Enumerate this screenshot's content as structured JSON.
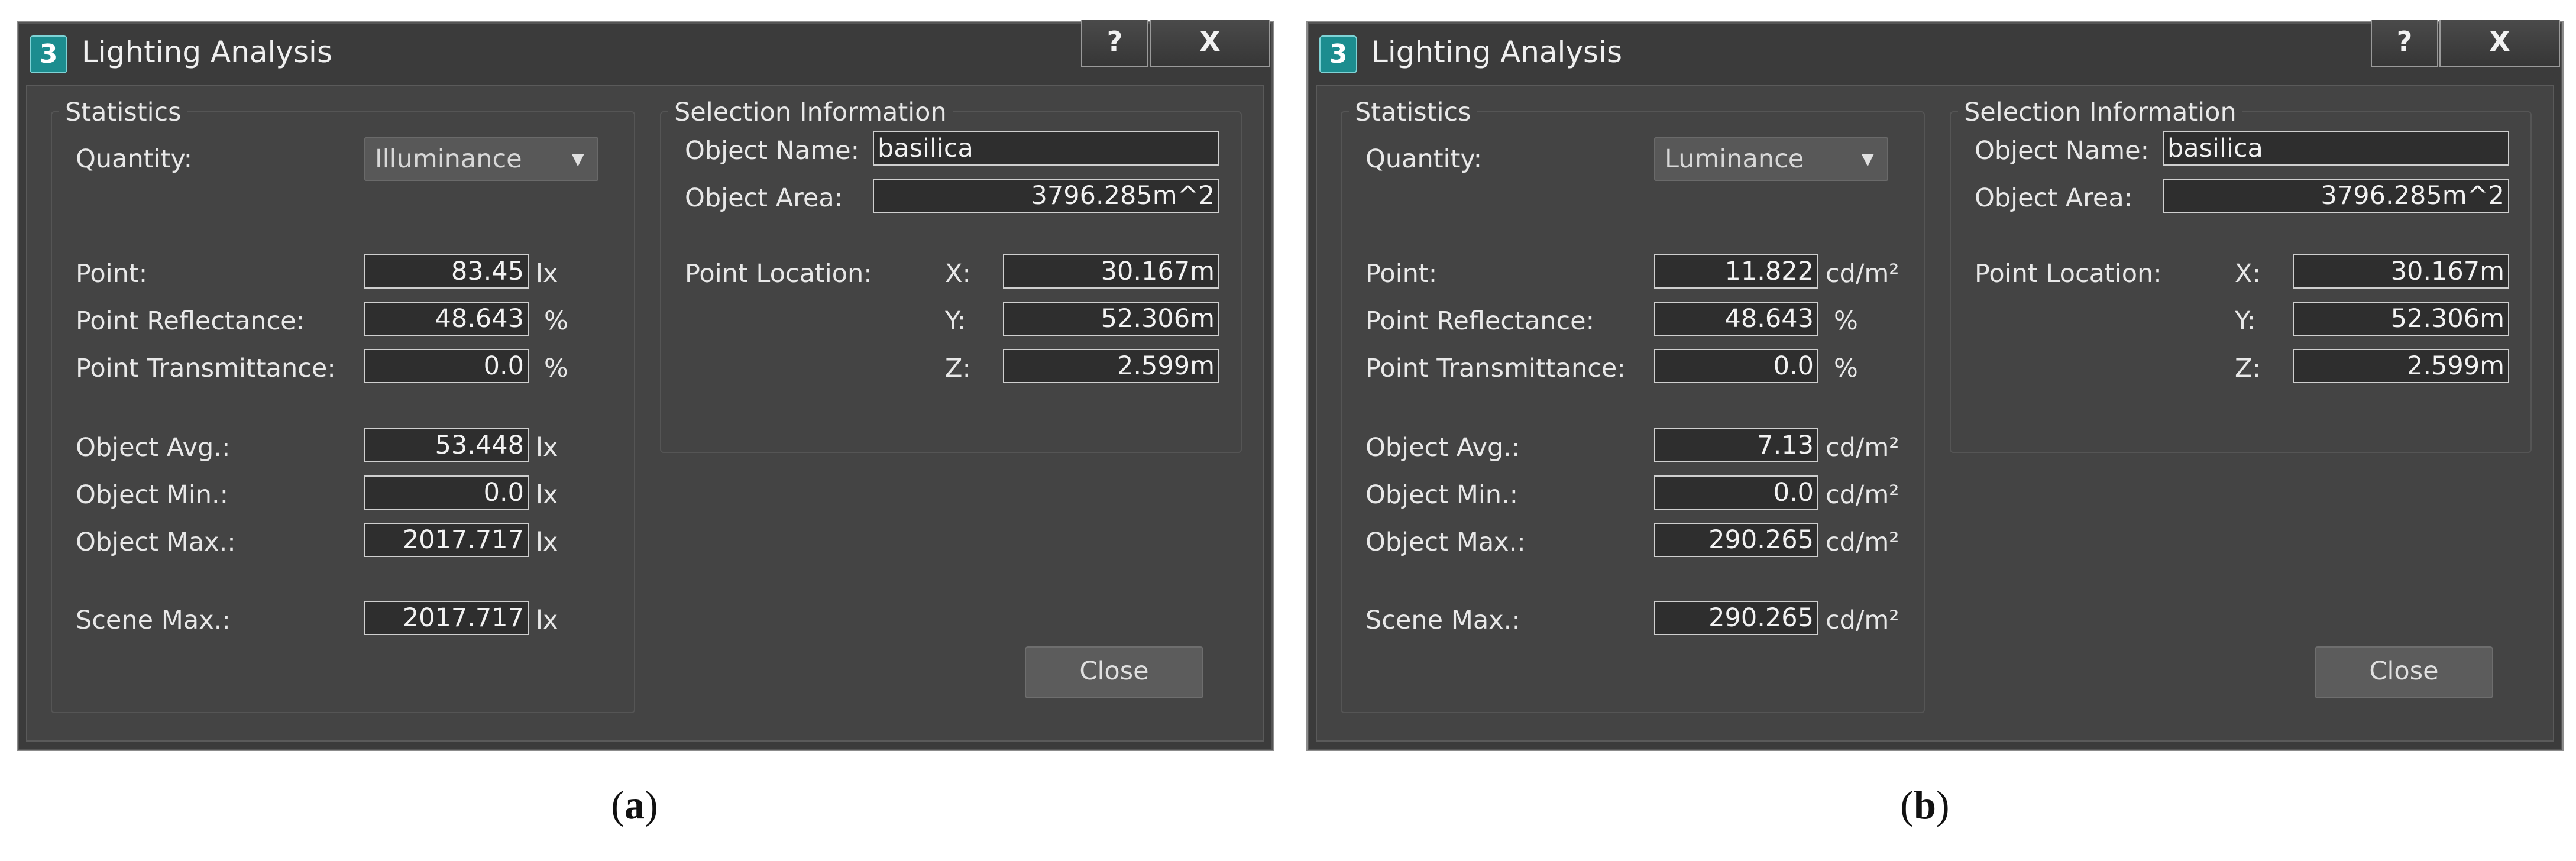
{
  "panels": [
    {
      "title": "Lighting Analysis",
      "app_icon": "3",
      "help_label": "?",
      "close_x_label": "X",
      "statistics_title": "Statistics",
      "quantity_label": "Quantity:",
      "quantity_value": "Illuminance",
      "point_label": "Point:",
      "point_value": "83.45",
      "point_unit": "lx",
      "reflectance_label": "Point Reflectance:",
      "reflectance_value": "48.643",
      "reflectance_unit": "%",
      "transmittance_label": "Point Transmittance:",
      "transmittance_value": "0.0",
      "transmittance_unit": "%",
      "avg_label": "Object  Avg.:",
      "avg_value": "53.448",
      "avg_unit": "lx",
      "min_label": "Object Min.:",
      "min_value": "0.0",
      "min_unit": "lx",
      "max_label": "Object Max.:",
      "max_value": "2017.717",
      "max_unit": "lx",
      "scene_max_label": "Scene Max.:",
      "scene_max_value": "2017.717",
      "scene_max_unit": "lx",
      "selection_title": "Selection Information",
      "object_name_label": "Object Name:",
      "object_name_value": "basilica",
      "object_area_label": "Object Area:",
      "object_area_value": "3796.285m^2",
      "point_location_label": "Point Location:",
      "x_label": "X:",
      "x_value": "30.167m",
      "y_label": "Y:",
      "y_value": "52.306m",
      "z_label": "Z:",
      "z_value": "2.599m",
      "close_button_label": "Close",
      "caption_open": "(",
      "caption_letter": "a",
      "caption_close": ")"
    },
    {
      "title": "Lighting Analysis",
      "app_icon": "3",
      "help_label": "?",
      "close_x_label": "X",
      "statistics_title": "Statistics",
      "quantity_label": "Quantity:",
      "quantity_value": "Luminance",
      "point_label": "Point:",
      "point_value": "11.822",
      "point_unit": "cd/m²",
      "reflectance_label": "Point Reflectance:",
      "reflectance_value": "48.643",
      "reflectance_unit": "%",
      "transmittance_label": "Point Transmittance:",
      "transmittance_value": "0.0",
      "transmittance_unit": "%",
      "avg_label": "Object  Avg.:",
      "avg_value": "7.13",
      "avg_unit": "cd/m²",
      "min_label": "Object Min.:",
      "min_value": "0.0",
      "min_unit": "cd/m²",
      "max_label": "Object Max.:",
      "max_value": "290.265",
      "max_unit": "cd/m²",
      "scene_max_label": "Scene Max.:",
      "scene_max_value": "290.265",
      "scene_max_unit": "cd/m²",
      "selection_title": "Selection Information",
      "object_name_label": "Object Name:",
      "object_name_value": "basilica",
      "object_area_label": "Object Area:",
      "object_area_value": "3796.285m^2",
      "point_location_label": "Point Location:",
      "x_label": "X:",
      "x_value": "30.167m",
      "y_label": "Y:",
      "y_value": "52.306m",
      "z_label": "Z:",
      "z_value": "2.599m",
      "close_button_label": "Close",
      "caption_open": "(",
      "caption_letter": "b",
      "caption_close": ")"
    }
  ],
  "icons": {
    "dropdown_arrow": "triangle-down-icon",
    "app_icon": "3ds-max-app-icon"
  },
  "colors": {
    "dialog_bg": "#3b3b3b",
    "inner_bg": "#444444",
    "app_icon": "#1c8d8f"
  }
}
